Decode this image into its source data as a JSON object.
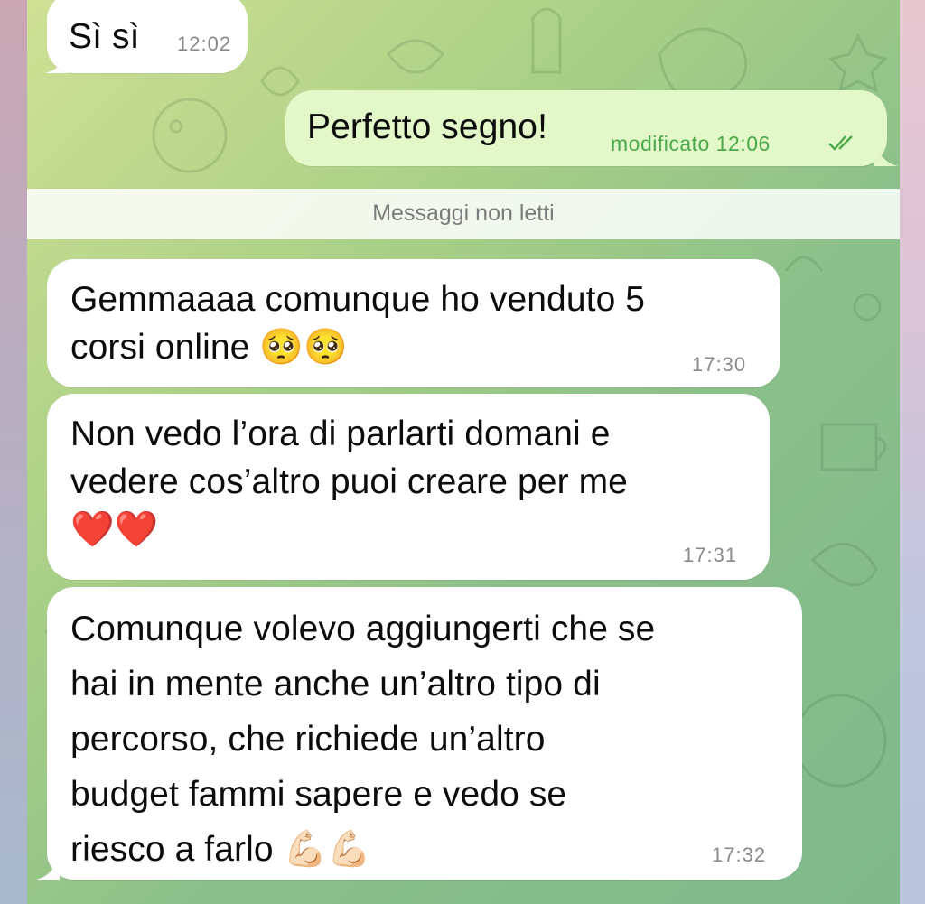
{
  "messages": [
    {
      "id": "m1",
      "direction": "in",
      "text": "Sì sì",
      "time": "12:02"
    },
    {
      "id": "m2",
      "direction": "out",
      "text": "Perfetto segno!",
      "status": "modificato 12:06",
      "read": true
    },
    {
      "id": "m3",
      "direction": "in",
      "text": "Gemmaaaa comunque ho venduto 5\ncorsi online 🥺🥺",
      "time": "17:30"
    },
    {
      "id": "m4",
      "direction": "in",
      "text": "Non vedo l’ora di parlarti domani e\nvedere cos’altro puoi creare per me\n❤️❤️",
      "time": "17:31"
    },
    {
      "id": "m5",
      "direction": "in",
      "text": "Comunque volevo aggiungerti che se\nhai in mente anche un’altro tipo di\npercorso, che richiede un’altro\nbudget fammi sapere e vedo se\nriesco a farlo 💪🏻💪🏻",
      "time": "17:32"
    }
  ],
  "divider": {
    "label": "Messaggi non letti"
  },
  "colors": {
    "incoming": "#ffffff",
    "outgoing": "#e3f8c9",
    "outgoing_meta": "#4ca84a",
    "incoming_meta": "#8a8a8a"
  },
  "icons": {
    "read_status": "double-check-icon"
  }
}
